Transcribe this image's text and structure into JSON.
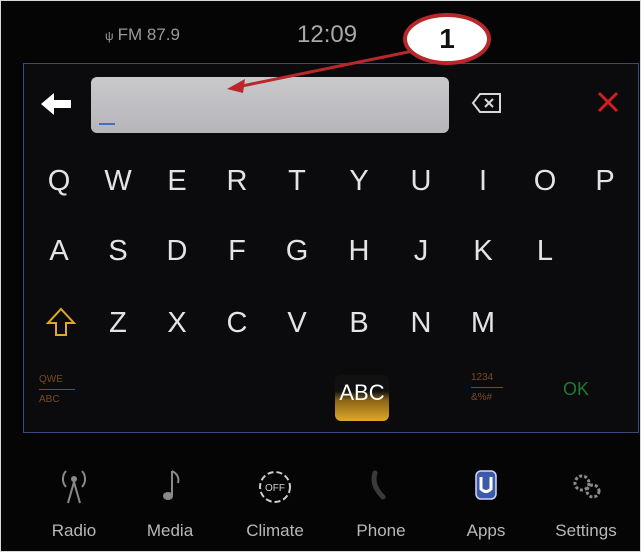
{
  "status_bar": {
    "radio_station": "FM 87.9",
    "clock": "12:09"
  },
  "keyboard": {
    "input_value": "",
    "rows": [
      [
        "Q",
        "W",
        "E",
        "R",
        "T",
        "Y",
        "U",
        "I",
        "O",
        "P"
      ],
      [
        "A",
        "S",
        "D",
        "F",
        "G",
        "H",
        "J",
        "K",
        "L"
      ],
      [
        "Z",
        "X",
        "C",
        "V",
        "B",
        "N",
        "M"
      ]
    ],
    "mode_key_top": "QWE",
    "mode_key_bottom": "ABC",
    "abc_label": "ABC",
    "num_key_top": "1234",
    "num_key_bottom": "&%#",
    "ok_label": "OK"
  },
  "nav": {
    "items": [
      {
        "label": "Radio",
        "icon": "radio-tower-icon"
      },
      {
        "label": "Media",
        "icon": "music-note-icon"
      },
      {
        "label": "Climate",
        "icon": "climate-off-icon"
      },
      {
        "label": "Phone",
        "icon": "phone-icon"
      },
      {
        "label": "Apps",
        "icon": "apps-icon"
      },
      {
        "label": "Settings",
        "icon": "settings-gear-icon"
      }
    ]
  },
  "callout": {
    "number": "1"
  },
  "colors": {
    "background": "#050505",
    "panel_border": "#3a4a7a",
    "accent_orange": "#e0a828",
    "close_red": "#d02020",
    "ok_green": "#1d7a2e",
    "callout_red": "#b8282a"
  }
}
